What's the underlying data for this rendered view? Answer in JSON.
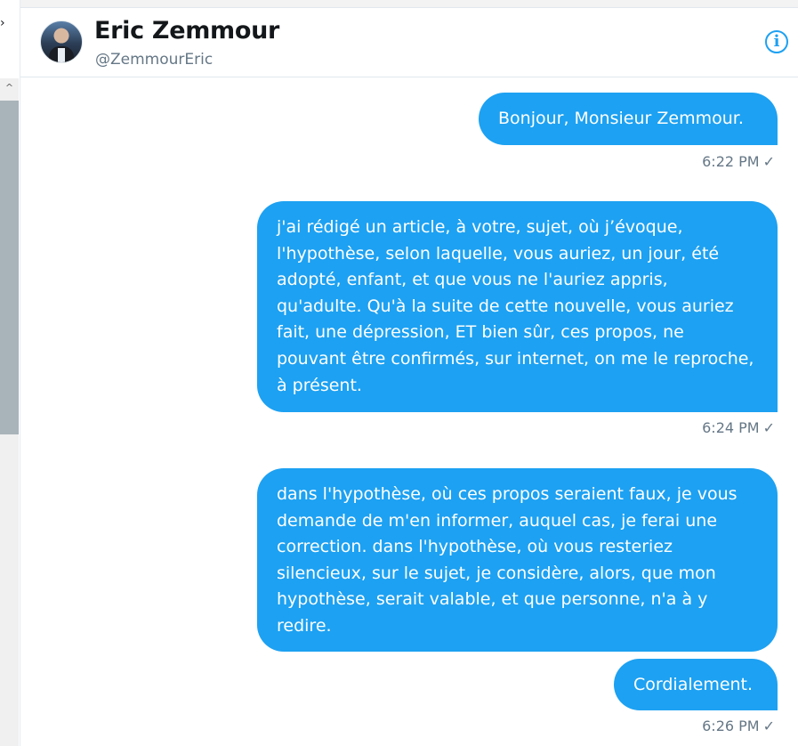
{
  "conversation": {
    "name": "Eric Zemmour",
    "handle": "@ZemmourEric",
    "info_icon": "ⓘ",
    "avatar_alt": "profile photo"
  },
  "messages": [
    {
      "text": "Bonjour, Monsieur Zemmour.",
      "time": "6:22 PM",
      "status": "✓"
    },
    {
      "text": "j'ai rédigé un article, à votre, sujet, où j’évoque, l'hypothèse, selon laquelle, vous auriez, un jour, été adopté, enfant, et que vous ne l'auriez appris, qu'adulte. Qu'à la suite de cette nouvelle, vous auriez fait, une dépression,  ET bien sûr, ces propos, ne pouvant être confirmés, sur internet, on me le reproche, à présent.",
      "time": "6:24 PM",
      "status": "✓"
    },
    {
      "text": "dans l'hypothèse, où ces propos seraient faux, je vous demande de m'en informer, auquel cas, je ferai une correction. dans l'hypothèse, où  vous resteriez silencieux, sur le sujet,  je considère, alors, que mon hypothèse, serait valable, et que personne, n'a à y redire.",
      "time": "",
      "status": ""
    },
    {
      "text": "Cordialement.",
      "time": "6:26 PM",
      "status": "✓"
    }
  ],
  "colors": {
    "bubble": "#1da1f2",
    "meta": "#657786",
    "name": "#14171a"
  },
  "scrollbar": {
    "up_arrow": "^"
  }
}
